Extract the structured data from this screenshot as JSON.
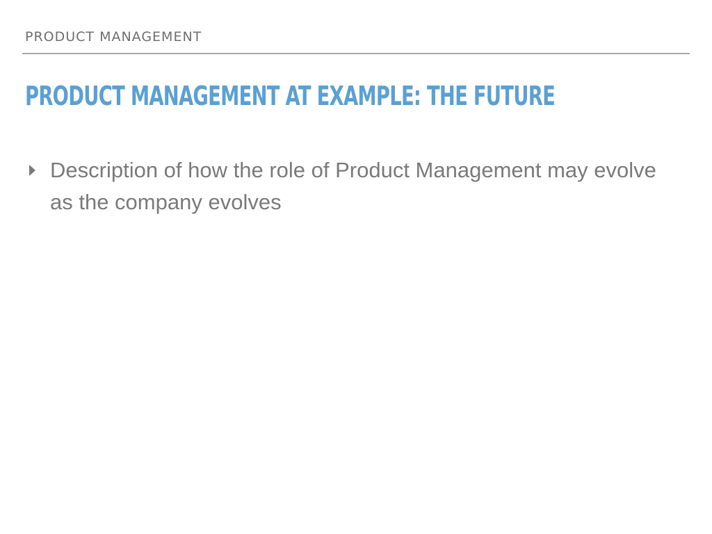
{
  "slide": {
    "section_header": "PRODUCT MANAGEMENT",
    "title": "PRODUCT MANAGEMENT AT EXAMPLE: THE FUTURE",
    "bullets": [
      {
        "icon": "triangle-bullet-icon",
        "text": "Description of how the role of Product Management may evolve as the company evolves"
      }
    ]
  },
  "colors": {
    "title": "#5aa0d4",
    "header_text": "#6e6e6e",
    "body_text": "#7a7a7a",
    "rule": "#a8a8a8",
    "background": "#ffffff"
  }
}
